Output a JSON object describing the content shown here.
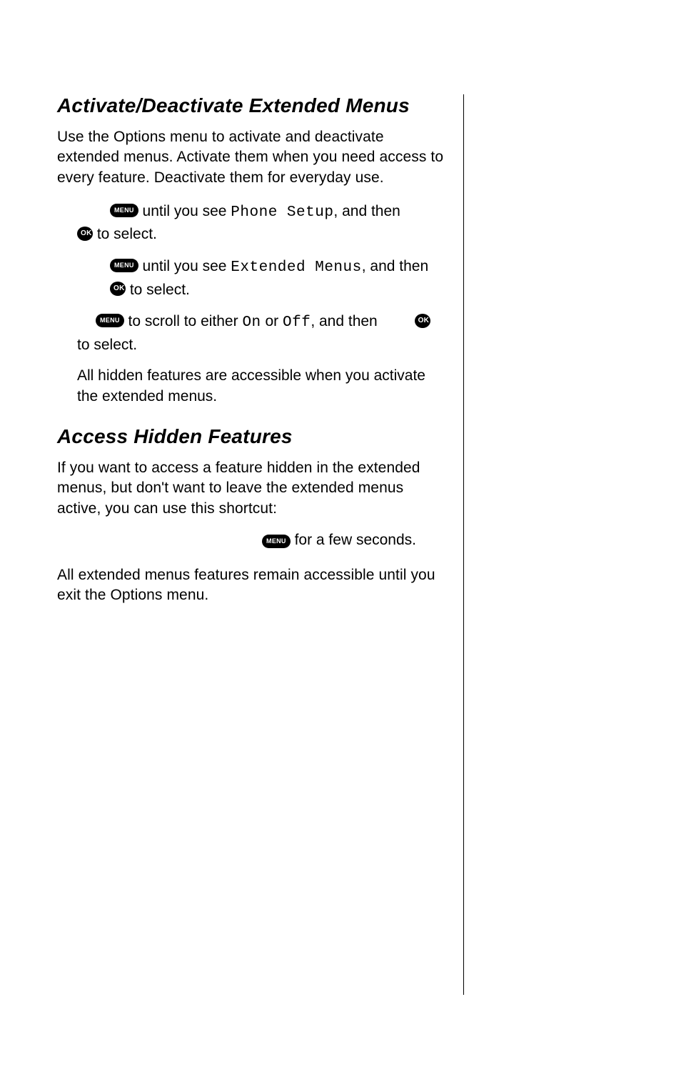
{
  "section1": {
    "title": "Activate/Deactivate Extended Menus",
    "intro": "Use the Options menu to activate and deactivate extended menus. Activate them when you need access to every feature. Deactivate them for everyday use.",
    "step1": {
      "t1": " until you see ",
      "lcd": "Phone Setup",
      "t2": ", and then ",
      "t3": " to select."
    },
    "step2": {
      "t1": " until you see ",
      "lcd": "Extended Menus",
      "t2": ", and then ",
      "t3": " to select."
    },
    "step3": {
      "t1": " to scroll to either ",
      "lcdOn": "On",
      "t2": " or ",
      "lcdOff": "Off",
      "t3": ", and then ",
      "t4": " to select."
    },
    "note": "All hidden features are accessible when you activate the extended menus."
  },
  "section2": {
    "title": "Access Hidden Features",
    "intro": "If you want to access a feature hidden in the extended menus, but don't want to leave the extended menus active, you can use this shortcut:",
    "action": " for a few seconds.",
    "outro": "All extended menus features remain accessible until you exit the Options menu."
  },
  "buttons": {
    "menu": "MENU",
    "ok": "OK"
  }
}
